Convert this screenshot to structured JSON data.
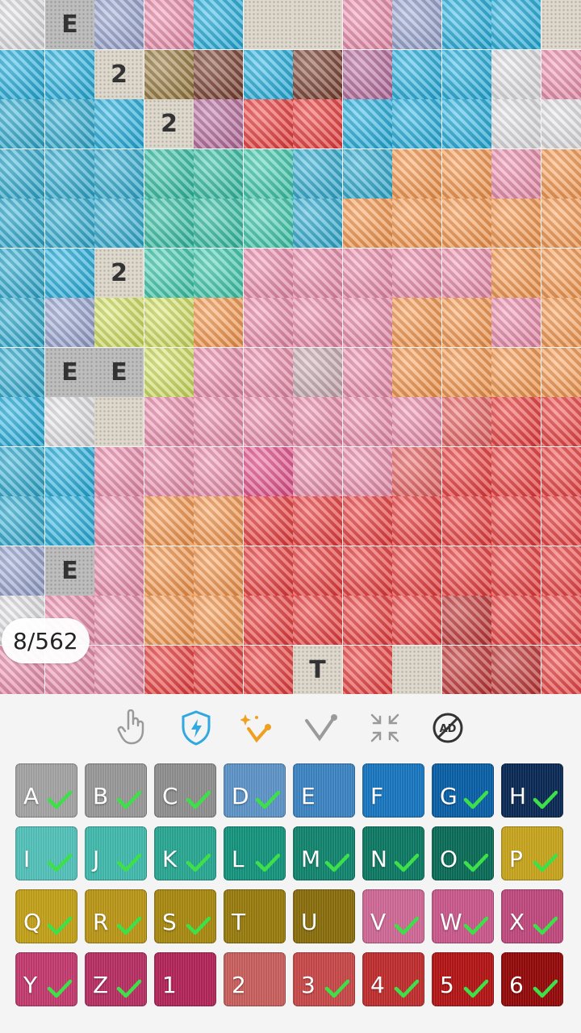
{
  "progress": "8/562",
  "toolbar": [
    {
      "name": "hand-tool-icon"
    },
    {
      "name": "shield-boost-icon"
    },
    {
      "name": "magic-wand-icon"
    },
    {
      "name": "brush-tool-icon"
    },
    {
      "name": "shrink-icon"
    },
    {
      "name": "no-ads-icon",
      "text": "AD"
    }
  ],
  "palette": [
    {
      "key": "A",
      "color": "#a5a5a5",
      "done": true
    },
    {
      "key": "B",
      "color": "#9a9a9a",
      "done": true
    },
    {
      "key": "C",
      "color": "#909090",
      "done": true
    },
    {
      "key": "D",
      "color": "#5f95c8",
      "done": true
    },
    {
      "key": "E",
      "color": "#3e86c4",
      "done": false
    },
    {
      "key": "F",
      "color": "#1a78c2",
      "done": false
    },
    {
      "key": "G",
      "color": "#0b61a8",
      "done": true
    },
    {
      "key": "H",
      "color": "#0a2a55",
      "done": true
    },
    {
      "key": "I",
      "color": "#54c3bb",
      "done": true
    },
    {
      "key": "J",
      "color": "#43bbae",
      "done": true
    },
    {
      "key": "K",
      "color": "#2aa894",
      "done": true
    },
    {
      "key": "L",
      "color": "#16957f",
      "done": true
    },
    {
      "key": "M",
      "color": "#12866f",
      "done": true
    },
    {
      "key": "N",
      "color": "#0e7a64",
      "done": true
    },
    {
      "key": "O",
      "color": "#0b6d58",
      "done": true
    },
    {
      "key": "P",
      "color": "#c9a61f",
      "done": true
    },
    {
      "key": "Q",
      "color": "#c4a21a",
      "done": true
    },
    {
      "key": "R",
      "color": "#bb9818",
      "done": true
    },
    {
      "key": "S",
      "color": "#a98a12",
      "done": true
    },
    {
      "key": "T",
      "color": "#9a7d10",
      "done": false
    },
    {
      "key": "U",
      "color": "#8b700e",
      "done": false
    },
    {
      "key": "V",
      "color": "#d06a98",
      "done": true
    },
    {
      "key": "W",
      "color": "#cb5a8d",
      "done": true
    },
    {
      "key": "X",
      "color": "#c24b7f",
      "done": true
    },
    {
      "key": "Y",
      "color": "#c43c70",
      "done": true
    },
    {
      "key": "Z",
      "color": "#b83065",
      "done": true
    },
    {
      "key": "1",
      "color": "#b3265a",
      "done": false
    },
    {
      "key": "2",
      "color": "#c9615f",
      "done": false
    },
    {
      "key": "3",
      "color": "#c94a4a",
      "done": true
    },
    {
      "key": "4",
      "color": "#c12f30",
      "done": true
    },
    {
      "key": "5",
      "color": "#b41616",
      "done": true
    },
    {
      "key": "6",
      "color": "#950a0a",
      "done": true
    }
  ],
  "grid": {
    "rows": [
      "w.gpb..pgbb..",
      "bbxtnbnubbwpp",
      "ccbxurrbbbwwo",
      "cccaamccoopoo",
      "cccaamcoooooo",
      "cb.mmpppppoop",
      "cgyyopppoopoo",
      "c..yppjpooooo",
      "bw.ppppppsrrr",
      "cbpppippsrrro",
      "cbpoorrrrrrrr",
      "g.poorrrrrrrrd",
      "wppoorrrrdrrr",
      "ppprrrrr.ddrr"
    ],
    "labels": [
      {
        "r": 0,
        "c": 1,
        "t": "E",
        "dark": true
      },
      {
        "r": 1,
        "c": 2,
        "t": "2"
      },
      {
        "r": 2,
        "c": 3,
        "t": "2"
      },
      {
        "r": 5,
        "c": 2,
        "t": "2"
      },
      {
        "r": 7,
        "c": 1,
        "t": "E",
        "dark": true
      },
      {
        "r": 7,
        "c": 2,
        "t": "E",
        "dark": true
      },
      {
        "r": 11,
        "c": 1,
        "t": "E",
        "dark": true
      },
      {
        "r": 13,
        "c": 6,
        "t": "T"
      }
    ]
  },
  "colors": {
    "b": "#1fb4e6",
    "c": "#2ab0d8",
    "w": "#e8e8ec",
    "g": "#9aa7d6",
    "p": "#f48fb0",
    "x": "#8a4a6a",
    "t": "#9a7a3a",
    "n": "#7a3b2a",
    "u": "#bb6aa0",
    "m": "#3ad0b0",
    "a": "#2fc5a8",
    "o": "#ff9a4a",
    "y": "#d8e860",
    "i": "#ee4f8f",
    "j": "#d0b0b8",
    "s": "#f06060",
    "r": "#f43a3a",
    "d": "#c73030"
  }
}
